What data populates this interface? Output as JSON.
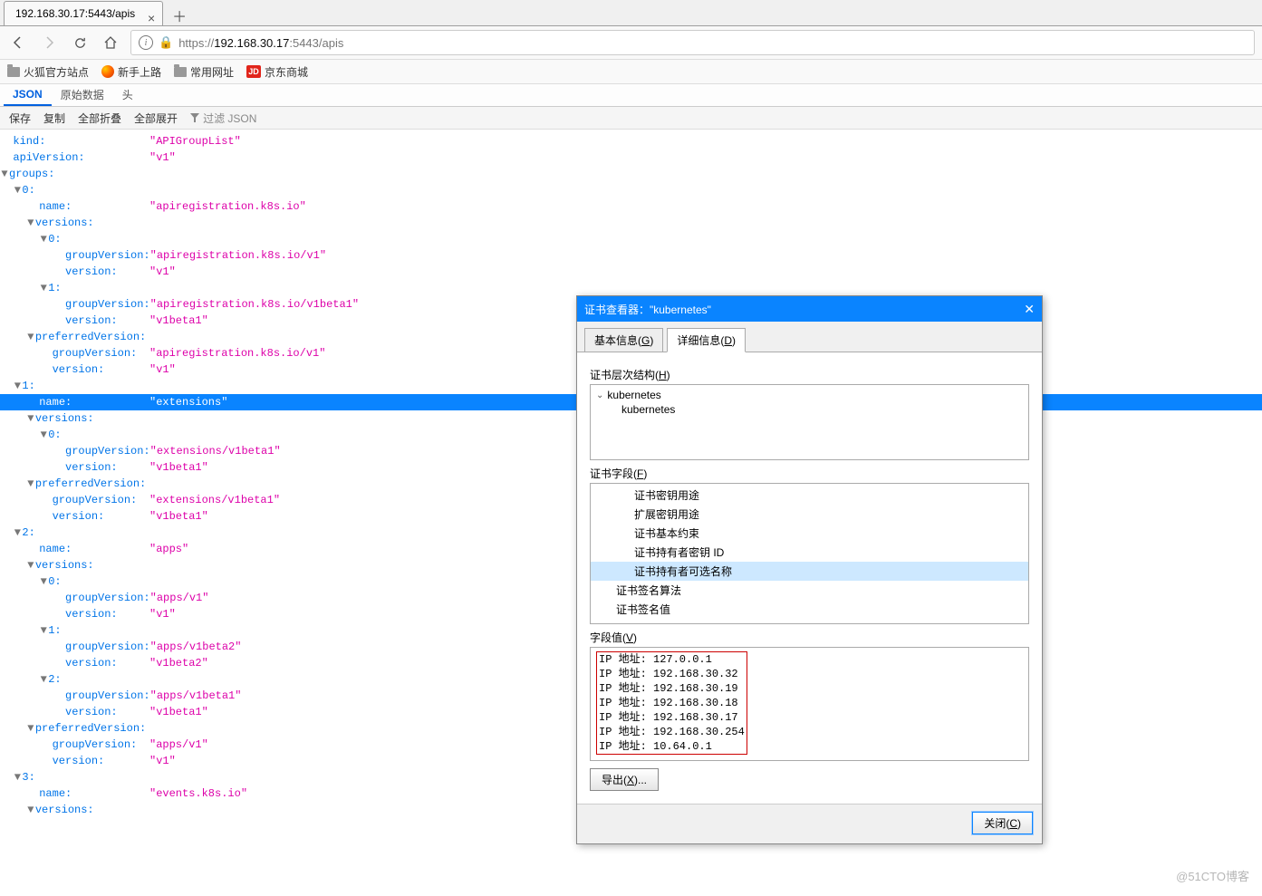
{
  "browser": {
    "tab_title": "192.168.30.17:5443/apis",
    "url_prefix": "https://",
    "url_host": "192.168.30.17",
    "url_suffix": ":5443/apis"
  },
  "bookmarks": {
    "b1": "火狐官方站点",
    "b2": "新手上路",
    "b3": "常用网址",
    "b4": "京东商城",
    "jd": "JD"
  },
  "json_tabs": {
    "t1": "JSON",
    "t2": "原始数据",
    "t3": "头"
  },
  "toolbar": {
    "save": "保存",
    "copy": "复制",
    "collapse": "全部折叠",
    "expand": "全部展开",
    "filter_ph": "过滤 JSON"
  },
  "json": {
    "kind_k": "kind:",
    "kind_v": "\"APIGroupList\"",
    "apiver_k": "apiVersion:",
    "apiver_v": "\"v1\"",
    "groups_k": "groups:",
    "g0": "0:",
    "g1": "1:",
    "g2": "2:",
    "g3": "3:",
    "name_k": "name:",
    "versions_k": "versions:",
    "pref_k": "preferredVersion:",
    "gv_k": "groupVersion:",
    "ver_k": "version:",
    "v0": "0:",
    "v1": "1:",
    "v2": "2:",
    "name_apireg": "\"apiregistration.k8s.io\"",
    "gv_apireg_v1": "\"apiregistration.k8s.io/v1\"",
    "gv_apireg_v1b1": "\"apiregistration.k8s.io/v1beta1\"",
    "v_v1": "\"v1\"",
    "v_v1b1": "\"v1beta1\"",
    "v_v1b2": "\"v1beta2\"",
    "name_ext": "\"extensions\"",
    "gv_ext": "\"extensions/v1beta1\"",
    "name_apps": "\"apps\"",
    "gv_apps_v1": "\"apps/v1\"",
    "gv_apps_v1b2": "\"apps/v1beta2\"",
    "gv_apps_v1b1": "\"apps/v1beta1\"",
    "name_events": "\"events.k8s.io\""
  },
  "dialog": {
    "title": "证书查看器：\"kubernetes\"",
    "tab_general": "基本信息(G)",
    "tab_detail": "详细信息(D)",
    "hier_label": "证书层次结构(H)",
    "hier_parent": "kubernetes",
    "hier_child": "kubernetes",
    "fields_label": "证书字段(F)",
    "fields": {
      "f1": "证书密钥用途",
      "f2": "扩展密钥用途",
      "f3": "证书基本约束",
      "f4": "证书持有者密钥 ID",
      "f5": "证书持有者可选名称",
      "f6": "证书签名算法",
      "f7": "证书签名值"
    },
    "value_label": "字段值(V)",
    "values": [
      "IP 地址: 127.0.0.1",
      "IP 地址: 192.168.30.32",
      "IP 地址: 192.168.30.19",
      "IP 地址: 192.168.30.18",
      "IP 地址: 192.168.30.17",
      "IP 地址: 192.168.30.254",
      "IP 地址: 10.64.0.1"
    ],
    "export_btn": "导出(X)...",
    "close_btn": "关闭(C)"
  },
  "watermark": "@51CTO博客"
}
